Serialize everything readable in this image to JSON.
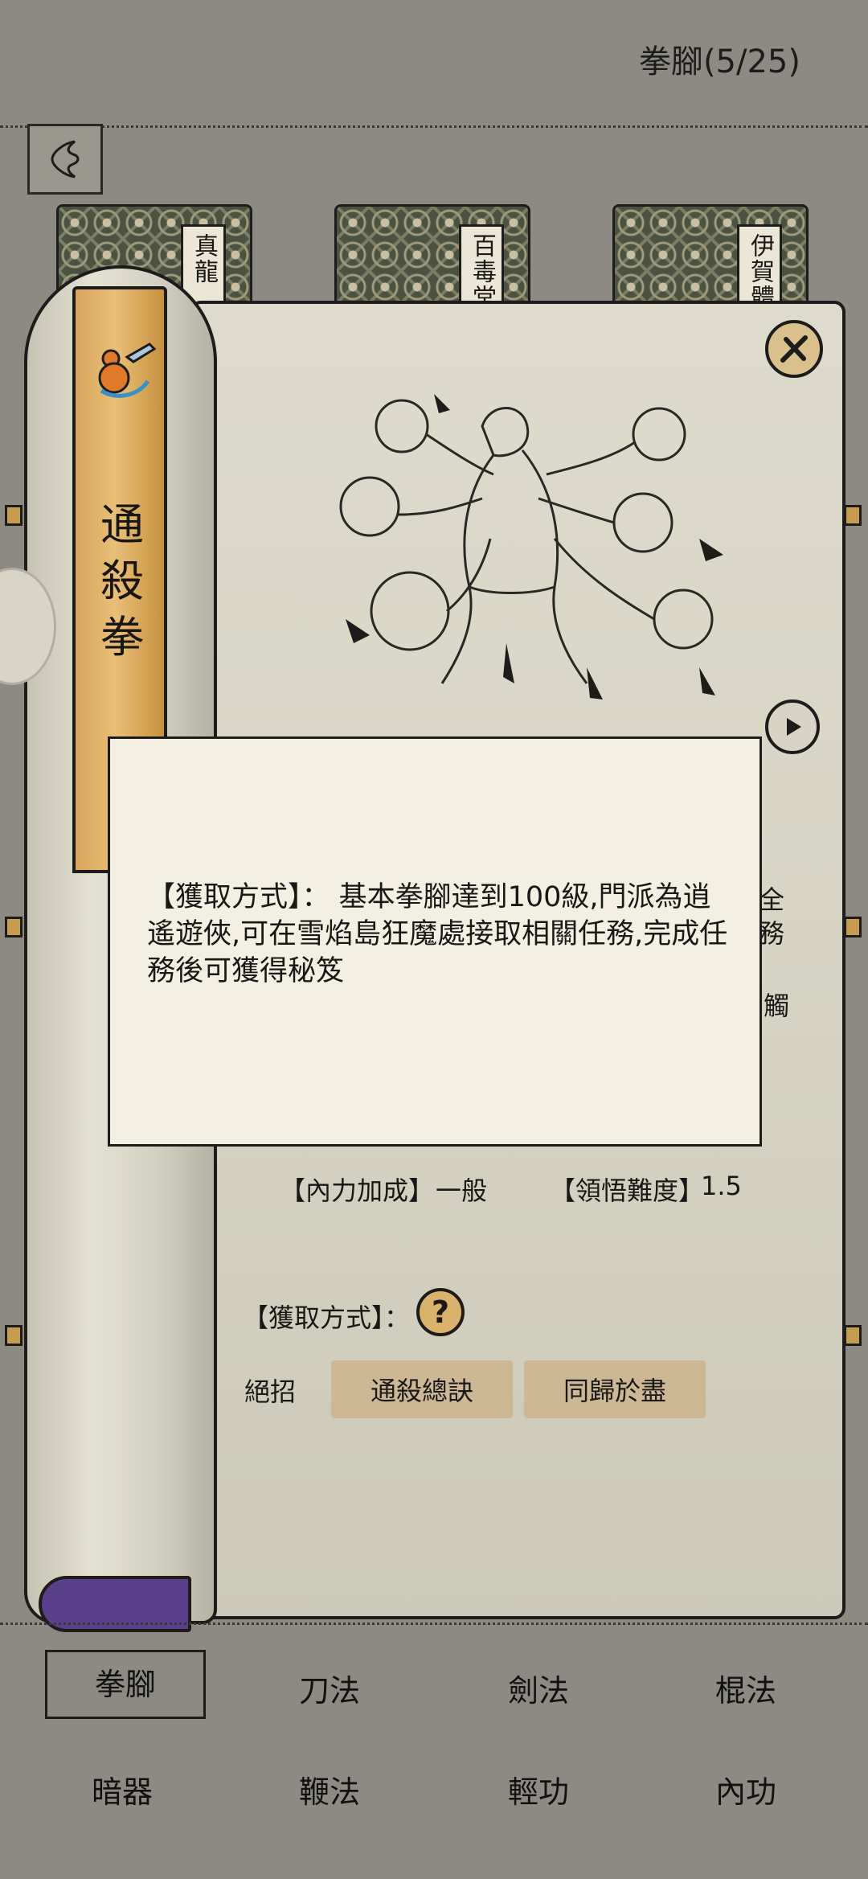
{
  "header": {
    "title": "拳腳(5/25)"
  },
  "books": [
    {
      "name": "真龍"
    },
    {
      "name": "百毒堂"
    },
    {
      "name": "伊賀體"
    }
  ],
  "skill": {
    "name": "通殺拳",
    "internal_bonus_label": "【內力加成】",
    "internal_bonus_value": "一般",
    "difficulty_label": "【領悟難度】",
    "difficulty_value": "1.5",
    "acquire_label": "【獲取方式】：",
    "help_glyph": "?",
    "moves_label": "絕招",
    "moves": [
      "通殺總訣",
      "同歸於盡"
    ],
    "hidden_peek": [
      "全",
      "務",
      "觸"
    ]
  },
  "tooltip": {
    "text": "【獲取方式】： 基本拳腳達到100級,門派為逍遙遊俠,可在雪焰島狂魔處接取相關任務,完成任務後可獲得秘笈"
  },
  "nav": {
    "tabs": [
      "拳腳",
      "刀法",
      "劍法",
      "棍法",
      "暗器",
      "鞭法",
      "輕功",
      "內功"
    ],
    "active": "拳腳"
  },
  "colors": {
    "background": "#8c8a83",
    "scroll": "#dedbcc",
    "gold": "#e9bf78",
    "move_button": "#cdb795",
    "tooltip": "#f4efe3"
  }
}
